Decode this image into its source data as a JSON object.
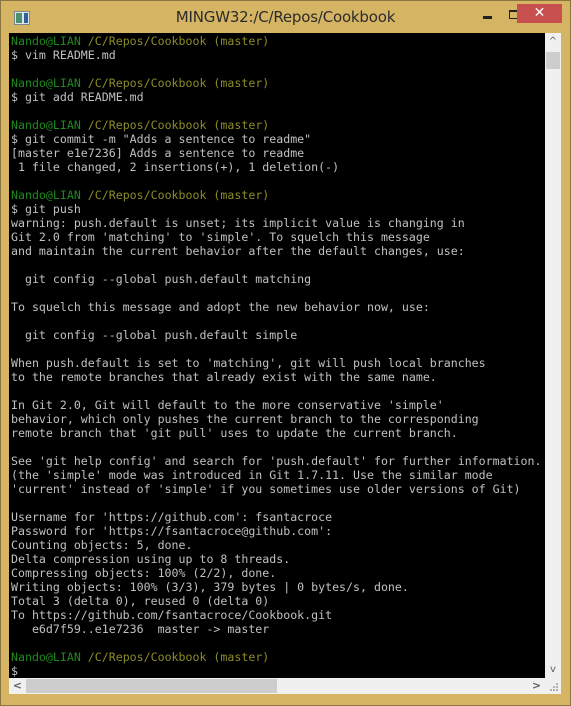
{
  "window": {
    "title": "MINGW32:/C/Repos/Cookbook",
    "icon": "terminal-app-icon",
    "controls": {
      "minimize": "minimize-icon",
      "maximize": "maximize-icon",
      "close_label": "✕"
    },
    "colors": {
      "frame": "#d5b563",
      "close": "#c7504f",
      "terminal_bg": "#000000",
      "user_host": "#1e8a1e",
      "path": "#8c8c28",
      "text": "#c0c0c0"
    }
  },
  "terminal": {
    "lines": [
      {
        "type": "prompt",
        "user": "Nando@LIAN",
        "path": "/C/Repos/Cookbook (master)"
      },
      {
        "type": "text",
        "text": "$ vim README.md"
      },
      {
        "type": "text",
        "text": ""
      },
      {
        "type": "prompt",
        "user": "Nando@LIAN",
        "path": "/C/Repos/Cookbook (master)"
      },
      {
        "type": "text",
        "text": "$ git add README.md"
      },
      {
        "type": "text",
        "text": ""
      },
      {
        "type": "prompt",
        "user": "Nando@LIAN",
        "path": "/C/Repos/Cookbook (master)"
      },
      {
        "type": "text",
        "text": "$ git commit -m \"Adds a sentence to readme\""
      },
      {
        "type": "text",
        "text": "[master e1e7236] Adds a sentence to readme"
      },
      {
        "type": "text",
        "text": " 1 file changed, 2 insertions(+), 1 deletion(-)"
      },
      {
        "type": "text",
        "text": ""
      },
      {
        "type": "prompt",
        "user": "Nando@LIAN",
        "path": "/C/Repos/Cookbook (master)"
      },
      {
        "type": "text",
        "text": "$ git push"
      },
      {
        "type": "text",
        "text": "warning: push.default is unset; its implicit value is changing in"
      },
      {
        "type": "text",
        "text": "Git 2.0 from 'matching' to 'simple'. To squelch this message"
      },
      {
        "type": "text",
        "text": "and maintain the current behavior after the default changes, use:"
      },
      {
        "type": "text",
        "text": ""
      },
      {
        "type": "text",
        "text": "  git config --global push.default matching"
      },
      {
        "type": "text",
        "text": ""
      },
      {
        "type": "text",
        "text": "To squelch this message and adopt the new behavior now, use:"
      },
      {
        "type": "text",
        "text": ""
      },
      {
        "type": "text",
        "text": "  git config --global push.default simple"
      },
      {
        "type": "text",
        "text": ""
      },
      {
        "type": "text",
        "text": "When push.default is set to 'matching', git will push local branches"
      },
      {
        "type": "text",
        "text": "to the remote branches that already exist with the same name."
      },
      {
        "type": "text",
        "text": ""
      },
      {
        "type": "text",
        "text": "In Git 2.0, Git will default to the more conservative 'simple'"
      },
      {
        "type": "text",
        "text": "behavior, which only pushes the current branch to the corresponding"
      },
      {
        "type": "text",
        "text": "remote branch that 'git pull' uses to update the current branch."
      },
      {
        "type": "text",
        "text": ""
      },
      {
        "type": "text",
        "text": "See 'git help config' and search for 'push.default' for further information."
      },
      {
        "type": "text",
        "text": "(the 'simple' mode was introduced in Git 1.7.11. Use the similar mode"
      },
      {
        "type": "text",
        "text": "'current' instead of 'simple' if you sometimes use older versions of Git)"
      },
      {
        "type": "text",
        "text": ""
      },
      {
        "type": "text",
        "text": "Username for 'https://github.com': fsantacroce"
      },
      {
        "type": "text",
        "text": "Password for 'https://fsantacroce@github.com':"
      },
      {
        "type": "text",
        "text": "Counting objects: 5, done."
      },
      {
        "type": "text",
        "text": "Delta compression using up to 8 threads."
      },
      {
        "type": "text",
        "text": "Compressing objects: 100% (2/2), done."
      },
      {
        "type": "text",
        "text": "Writing objects: 100% (3/3), 379 bytes | 0 bytes/s, done."
      },
      {
        "type": "text",
        "text": "Total 3 (delta 0), reused 0 (delta 0)"
      },
      {
        "type": "text",
        "text": "To https://github.com/fsantacroce/Cookbook.git"
      },
      {
        "type": "text",
        "text": "   e6d7f59..e1e7236  master -> master"
      },
      {
        "type": "text",
        "text": ""
      },
      {
        "type": "prompt",
        "user": "Nando@LIAN",
        "path": "/C/Repos/Cookbook (master)"
      },
      {
        "type": "text",
        "text": "$"
      }
    ]
  },
  "scrollbars": {
    "vertical": {
      "up_icon": "^",
      "down_icon": "v",
      "position_fraction": 0.0
    },
    "horizontal": {
      "left_icon": "<",
      "right_icon": ">",
      "visible_fraction": 0.5,
      "position_fraction": 0.0
    }
  }
}
